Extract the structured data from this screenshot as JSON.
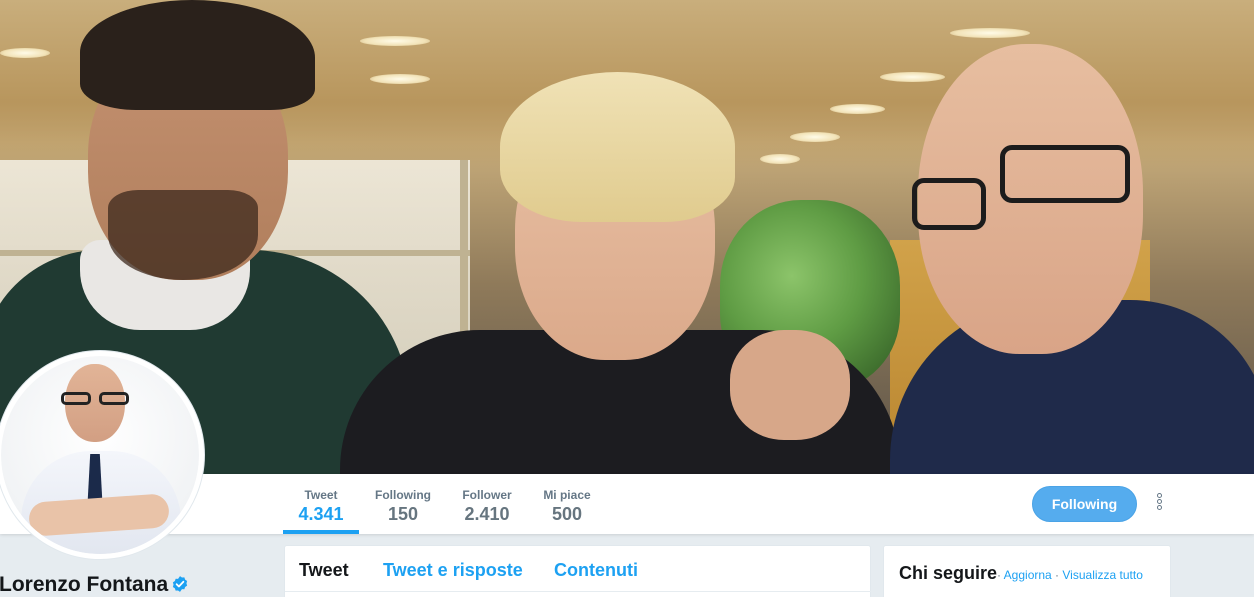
{
  "profile": {
    "name": "Lorenzo Fontana",
    "verified": true
  },
  "stats": [
    {
      "label": "Tweet",
      "value": "4.341",
      "active": true
    },
    {
      "label": "Following",
      "value": "150",
      "active": false
    },
    {
      "label": "Follower",
      "value": "2.410",
      "active": false
    },
    {
      "label": "Mi piace",
      "value": "500",
      "active": false
    }
  ],
  "actions": {
    "follow_label": "Following",
    "more_icon": "more-vertical-icon"
  },
  "timeline_tabs": [
    {
      "label": "Tweet",
      "active": true
    },
    {
      "label": "Tweet e risposte",
      "active": false
    },
    {
      "label": "Contenuti",
      "active": false
    }
  ],
  "who_to_follow": {
    "title": "Chi seguire",
    "separator": " · ",
    "refresh_label": "Aggiorna",
    "view_all_label": "Visualizza tutto"
  },
  "colors": {
    "accent": "#1da1f2",
    "follow_button": "#55acee",
    "background": "#e6ecf0"
  },
  "icons": {
    "verified": "verified-badge-icon"
  }
}
